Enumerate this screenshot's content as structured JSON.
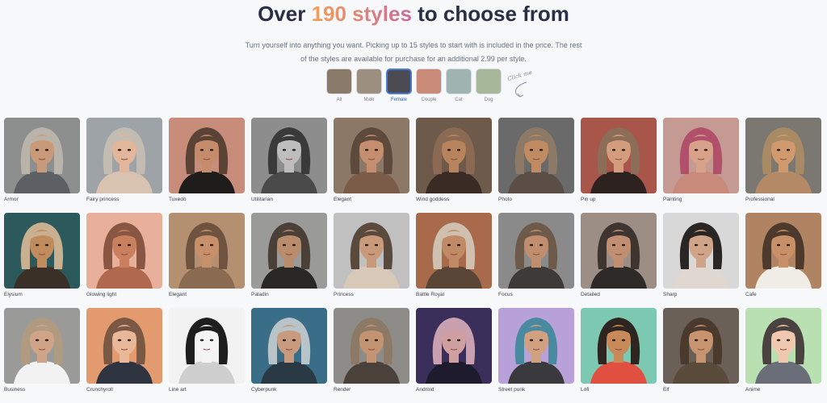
{
  "header": {
    "title_pre": "Over ",
    "title_accent": "190 styles",
    "title_post": " to choose from",
    "subtitle": "Turn yourself into anything you want. Picking up to 15 styles to start with is included in the price. The rest of the styles are available for purchase for an additional 2.99 per style."
  },
  "filters": [
    {
      "label": "All",
      "active": false,
      "bg": "#8a7a6a"
    },
    {
      "label": "Male",
      "active": false,
      "bg": "#9c8f80"
    },
    {
      "label": "Female",
      "active": true,
      "bg": "#4c4a52"
    },
    {
      "label": "Couple",
      "active": false,
      "bg": "#c98a78"
    },
    {
      "label": "Cat",
      "active": false,
      "bg": "#9fb4b0"
    },
    {
      "label": "Dog",
      "active": false,
      "bg": "#a7b89a"
    }
  ],
  "click_hint": "Click me",
  "styles": [
    {
      "label": "Armor",
      "bg": "#8d8f8e",
      "hair": "#b9b3aa",
      "skin": "#c99a7a",
      "cloth": "#5c6064"
    },
    {
      "label": "Fairy princess",
      "bg": "#9ea3a8",
      "hair": "#c3bcb3",
      "skin": "#e2b69a",
      "cloth": "#d8c2b0"
    },
    {
      "label": "Tuxedo",
      "bg": "#c88c7a",
      "hair": "#5a4234",
      "skin": "#c58c6c",
      "cloth": "#1f1c1c"
    },
    {
      "label": "Utilitarian",
      "bg": "#8d8d8d",
      "hair": "#3a3a3a",
      "skin": "#bdbdbd",
      "cloth": "#4a4a4a"
    },
    {
      "label": "Elegant",
      "bg": "#8b7866",
      "hair": "#5e4a3c",
      "skin": "#c58e6e",
      "cloth": "#7a5c48"
    },
    {
      "label": "Wind goddess",
      "bg": "#6e5a4a",
      "hair": "#8a6a52",
      "skin": "#b8845e",
      "cloth": "#3a2c24"
    },
    {
      "label": "Photo",
      "bg": "#6a6a6a",
      "hair": "#8c7a66",
      "skin": "#c08a62",
      "cloth": "#5a4e46"
    },
    {
      "label": "Pin up",
      "bg": "#a8564a",
      "hair": "#8c6e58",
      "skin": "#d39c7c",
      "cloth": "#2e2220"
    },
    {
      "label": "Painting",
      "bg": "#c49a92",
      "hair": "#b0506a",
      "skin": "#d8a28a",
      "cloth": "#c88a7a"
    },
    {
      "label": "Professional",
      "bg": "#7a7870",
      "hair": "#a88a64",
      "skin": "#d09a6e",
      "cloth": "#b48a66"
    },
    {
      "label": "Elysium",
      "bg": "#2c5a5c",
      "hair": "#c8b090",
      "skin": "#c08c5e",
      "cloth": "#3a3028"
    },
    {
      "label": "Glowing light",
      "bg": "#e8b09a",
      "hair": "#8a5644",
      "skin": "#c8805e",
      "cloth": "#b0684e"
    },
    {
      "label": "Elegant",
      "bg": "#b49070",
      "hair": "#6e5440",
      "skin": "#c8906a",
      "cloth": "#8a6a50"
    },
    {
      "label": "Paladin",
      "bg": "#9a9a98",
      "hair": "#4a4038",
      "skin": "#b88c6c",
      "cloth": "#2a2826"
    },
    {
      "label": "Princess",
      "bg": "#c0c0c0",
      "hair": "#5a4a3e",
      "skin": "#c89a7a",
      "cloth": "#d8c8b8"
    },
    {
      "label": "Battle Royal",
      "bg": "#a86a4a",
      "hair": "#d0c0b0",
      "skin": "#c08a66",
      "cloth": "#5a4636"
    },
    {
      "label": "Focus",
      "bg": "#8a8a8a",
      "hair": "#6e5a4a",
      "skin": "#c08e6e",
      "cloth": "#3e3a38"
    },
    {
      "label": "Detailed",
      "bg": "#9c8e84",
      "hair": "#3e3430",
      "skin": "#c08e70",
      "cloth": "#2e2a28"
    },
    {
      "label": "Sharp",
      "bg": "#d8d8d8",
      "hair": "#2a2624",
      "skin": "#d0a488",
      "cloth": "#e0d8d0"
    },
    {
      "label": "Cafe",
      "bg": "#b08462",
      "hair": "#4e3a2c",
      "skin": "#c89068",
      "cloth": "#f0ece6"
    },
    {
      "label": "Business",
      "bg": "#9a9a98",
      "hair": "#b09a80",
      "skin": "#d0a488",
      "cloth": "#f2f2f2"
    },
    {
      "label": "Crunchyroll",
      "bg": "#e29a6e",
      "hair": "#7a5844",
      "skin": "#e8b898",
      "cloth": "#2e3440"
    },
    {
      "label": "Line art",
      "bg": "#f2f2f2",
      "hair": "#1e1e1e",
      "skin": "#f4f4f4",
      "cloth": "#cfcfcf"
    },
    {
      "label": "Cyberpunk",
      "bg": "#3a6e88",
      "hair": "#b8c4c8",
      "skin": "#c89a7e",
      "cloth": "#2a3a44"
    },
    {
      "label": "Render",
      "bg": "#8e8c88",
      "hair": "#8c7a66",
      "skin": "#c49472",
      "cloth": "#4a423a"
    },
    {
      "label": "Android",
      "bg": "#3a2e5a",
      "hair": "#c8a0b0",
      "skin": "#d0a0a0",
      "cloth": "#1e1c2c"
    },
    {
      "label": "Street punk",
      "bg": "#b8a0d8",
      "hair": "#4a8aa0",
      "skin": "#d0a080",
      "cloth": "#3a3a3e"
    },
    {
      "label": "Lofi",
      "bg": "#7cc8b0",
      "hair": "#2e2420",
      "skin": "#c88a58",
      "cloth": "#e05040"
    },
    {
      "label": "Elf",
      "bg": "#6a6058",
      "hair": "#4a3a2e",
      "skin": "#c89470",
      "cloth": "#5a4a3a"
    },
    {
      "label": "Anime",
      "bg": "#b8e0b0",
      "hair": "#4a4240",
      "skin": "#f0c8b0",
      "cloth": "#6a6e78"
    }
  ]
}
